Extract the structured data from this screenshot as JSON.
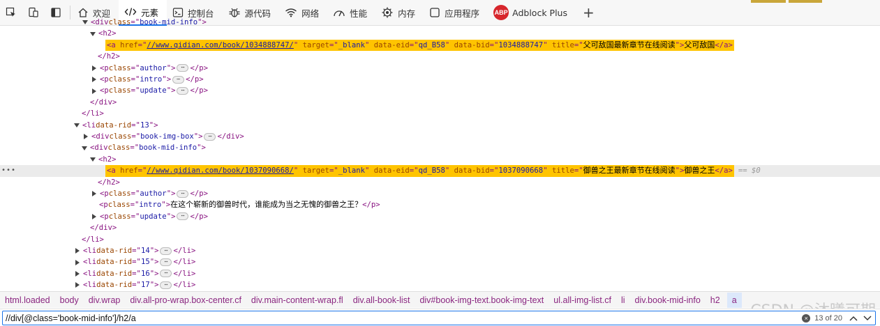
{
  "toolbar": {
    "icons": [
      "inspect-icon",
      "device-toolbar-icon",
      "dock-icon"
    ],
    "tabs": [
      {
        "label": "欢迎",
        "icon": "home-icon",
        "active": false
      },
      {
        "label": "元素",
        "icon": "code-tags-icon",
        "active": true
      },
      {
        "label": "控制台",
        "icon": "console-icon",
        "active": false
      },
      {
        "label": "源代码",
        "icon": "bug-icon",
        "active": false
      },
      {
        "label": "网络",
        "icon": "wifi-icon",
        "active": false
      },
      {
        "label": "性能",
        "icon": "performance-icon",
        "active": false
      },
      {
        "label": "内存",
        "icon": "memory-icon",
        "active": false
      },
      {
        "label": "应用程序",
        "icon": "application-icon",
        "active": false
      },
      {
        "label": "Adblock Plus",
        "icon": "abp-icon",
        "active": false
      }
    ],
    "abp_badge": "ABP",
    "add_tab": "+"
  },
  "tree": {
    "row0": {
      "tag_open": "<div ",
      "attr": "class",
      "eq": "=\"",
      "val": "book-mid-info",
      "close": "\">"
    },
    "row1": {
      "tag": "<h2>"
    },
    "row2": {
      "tag_open": "<a ",
      "href_attr": "href",
      "href": "//www.qidian.com/book/1034888747/",
      "target_attr": "target",
      "target": "_blank",
      "eid_attr": "data-eid",
      "eid": "qd_B58",
      "bid_attr": "data-bid",
      "bid": "1034888747",
      "title_attr": "title",
      "title": "父可敌国最新章节在线阅读",
      "text": "父可敌国",
      "tag_close": "</a>"
    },
    "row3": {
      "tag": "</h2>"
    },
    "row4": {
      "tag_open": "<p ",
      "attr": "class",
      "val": "author",
      "ell": "⋯",
      "tag_close": "</p>"
    },
    "row5": {
      "tag_open": "<p ",
      "attr": "class",
      "val": "intro",
      "ell": "⋯",
      "tag_close": "</p>"
    },
    "row6": {
      "tag_open": "<p ",
      "attr": "class",
      "val": "update",
      "ell": "⋯",
      "tag_close": "</p>"
    },
    "row7": {
      "tag": "</div>"
    },
    "row8": {
      "tag": "</li>"
    },
    "row9": {
      "tag_open": "<li ",
      "attr": "data-rid",
      "val": "13"
    },
    "row10": {
      "tag_open": "<div ",
      "attr": "class",
      "val": "book-img-box",
      "ell": "⋯",
      "tag_close": "</div>"
    },
    "row11": {
      "tag_open": "<div ",
      "attr": "class",
      "val": "book-mid-info"
    },
    "row12": {
      "tag": "<h2>"
    },
    "row13": {
      "gutter": "•••",
      "tag_open": "<a ",
      "href_attr": "href",
      "href": "//www.qidian.com/book/1037090668/",
      "target_attr": "target",
      "target": "_blank",
      "eid_attr": "data-eid",
      "eid": "qd_B58",
      "bid_attr": "data-bid",
      "bid": "1037090668",
      "title_attr": "title",
      "title": "御兽之王最新章节在线阅读",
      "text": "御兽之王",
      "tag_close": "</a>",
      "eq_note": "== $0"
    },
    "row14": {
      "tag": "</h2>"
    },
    "row15": {
      "tag_open": "<p ",
      "attr": "class",
      "val": "author",
      "ell": "⋯",
      "tag_close": "</p>"
    },
    "row16": {
      "tag_open": "<p ",
      "attr": "class",
      "val": "intro",
      "text": " 在这个崭新的御兽时代，谁能成为当之无愧的御兽之王？ ",
      "tag_close": "</p>"
    },
    "row17": {
      "tag_open": "<p ",
      "attr": "class",
      "val": "update",
      "ell": "⋯",
      "tag_close": "</p>"
    },
    "row18": {
      "tag": "</div>"
    },
    "row19": {
      "tag": "</li>"
    },
    "row20": {
      "tag_open": "<li ",
      "attr": "data-rid",
      "val": "14",
      "ell": "⋯",
      "tag_close": "</li>"
    },
    "row21": {
      "tag_open": "<li ",
      "attr": "data-rid",
      "val": "15",
      "ell": "⋯",
      "tag_close": "</li>"
    },
    "row22": {
      "tag_open": "<li ",
      "attr": "data-rid",
      "val": "16",
      "ell": "⋯",
      "tag_close": "</li>"
    },
    "row23": {
      "tag_open": "<li ",
      "attr": "data-rid",
      "val": "17",
      "ell": "⋯",
      "tag_close": "</li>"
    }
  },
  "breadcrumb": [
    "html.loaded",
    "body",
    "div.wrap",
    "div.all-pro-wrap.box-center.cf",
    "div.main-content-wrap.fl",
    "div.all-book-list",
    "div#book-img-text.book-img-text",
    "ul.all-img-list.cf",
    "li",
    "div.book-mid-info",
    "h2",
    "a"
  ],
  "search": {
    "value": "//div[@class='book-mid-info']/h2/a",
    "match_count": "13 of 20",
    "clear": "×"
  },
  "watermark": "CSDN @沐曦可期",
  "colors": {
    "highlight": "#ffc400",
    "tag": "#881280",
    "attr": "#994500",
    "value": "#1a1aa6",
    "accent": "#1a73e8"
  }
}
